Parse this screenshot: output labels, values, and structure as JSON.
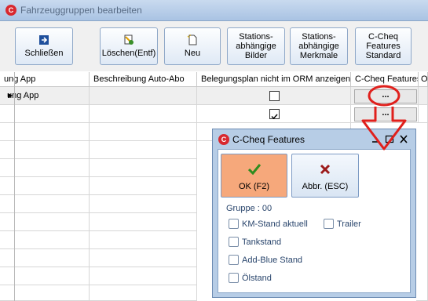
{
  "window": {
    "title": "Fahrzeuggruppen bearbeiten"
  },
  "toolbar": {
    "close_label": "Schließen",
    "delete_label": "Löschen(Entf)",
    "new_label": "Neu",
    "station_images_label": "Stations-\nabhängige\nBilder",
    "station_features_label": "Stations-\nabhängige\nMerkmale",
    "ccheq_std_label": "C-Cheq\nFeatures\nStandard"
  },
  "grid": {
    "columns": [
      "ung App",
      "Beschreibung Auto-Abo",
      "Belegungsplan nicht im ORM anzeigen",
      "C-Cheq Features",
      "O"
    ],
    "rows": [
      {
        "app": "ung App",
        "abo": "",
        "belegungsplan_checked": false,
        "ccheq_button": "..."
      },
      {
        "app": "",
        "abo": "",
        "belegungsplan_checked": true,
        "ccheq_button": "..."
      }
    ]
  },
  "dialog": {
    "title": "C-Cheq Features",
    "ok_label": "OK (F2)",
    "cancel_label": "Abbr. (ESC)",
    "group_label": "Gruppe : 00",
    "checkboxes": [
      "KM-Stand aktuell",
      "Trailer",
      "Tankstand",
      "Add-Blue Stand",
      "Ölstand"
    ]
  },
  "colors": {
    "accent_red": "#e0201c",
    "ok_button": "#f5a77a",
    "dialog_frame": "#b7cde6"
  }
}
